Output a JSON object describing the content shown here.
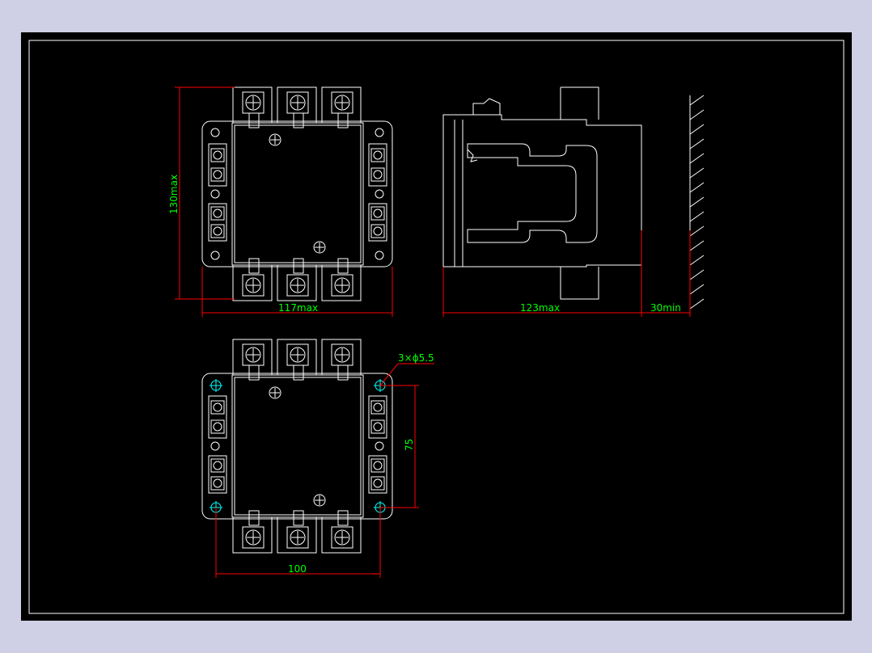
{
  "colors": {
    "background": "#cfd0e6",
    "sheet": "#000000",
    "outline": "#ffffff",
    "dimension": "#ff0000",
    "dimension_text": "#00ff00",
    "center_mark": "#00ffff"
  },
  "dimensions": {
    "height": "130max",
    "width_front": "117max",
    "depth": "123max",
    "clearance": "30min",
    "hole_callout": "3×ϕ5.5",
    "hole_vertical_spacing": "75",
    "hole_horizontal_spacing": "100"
  }
}
